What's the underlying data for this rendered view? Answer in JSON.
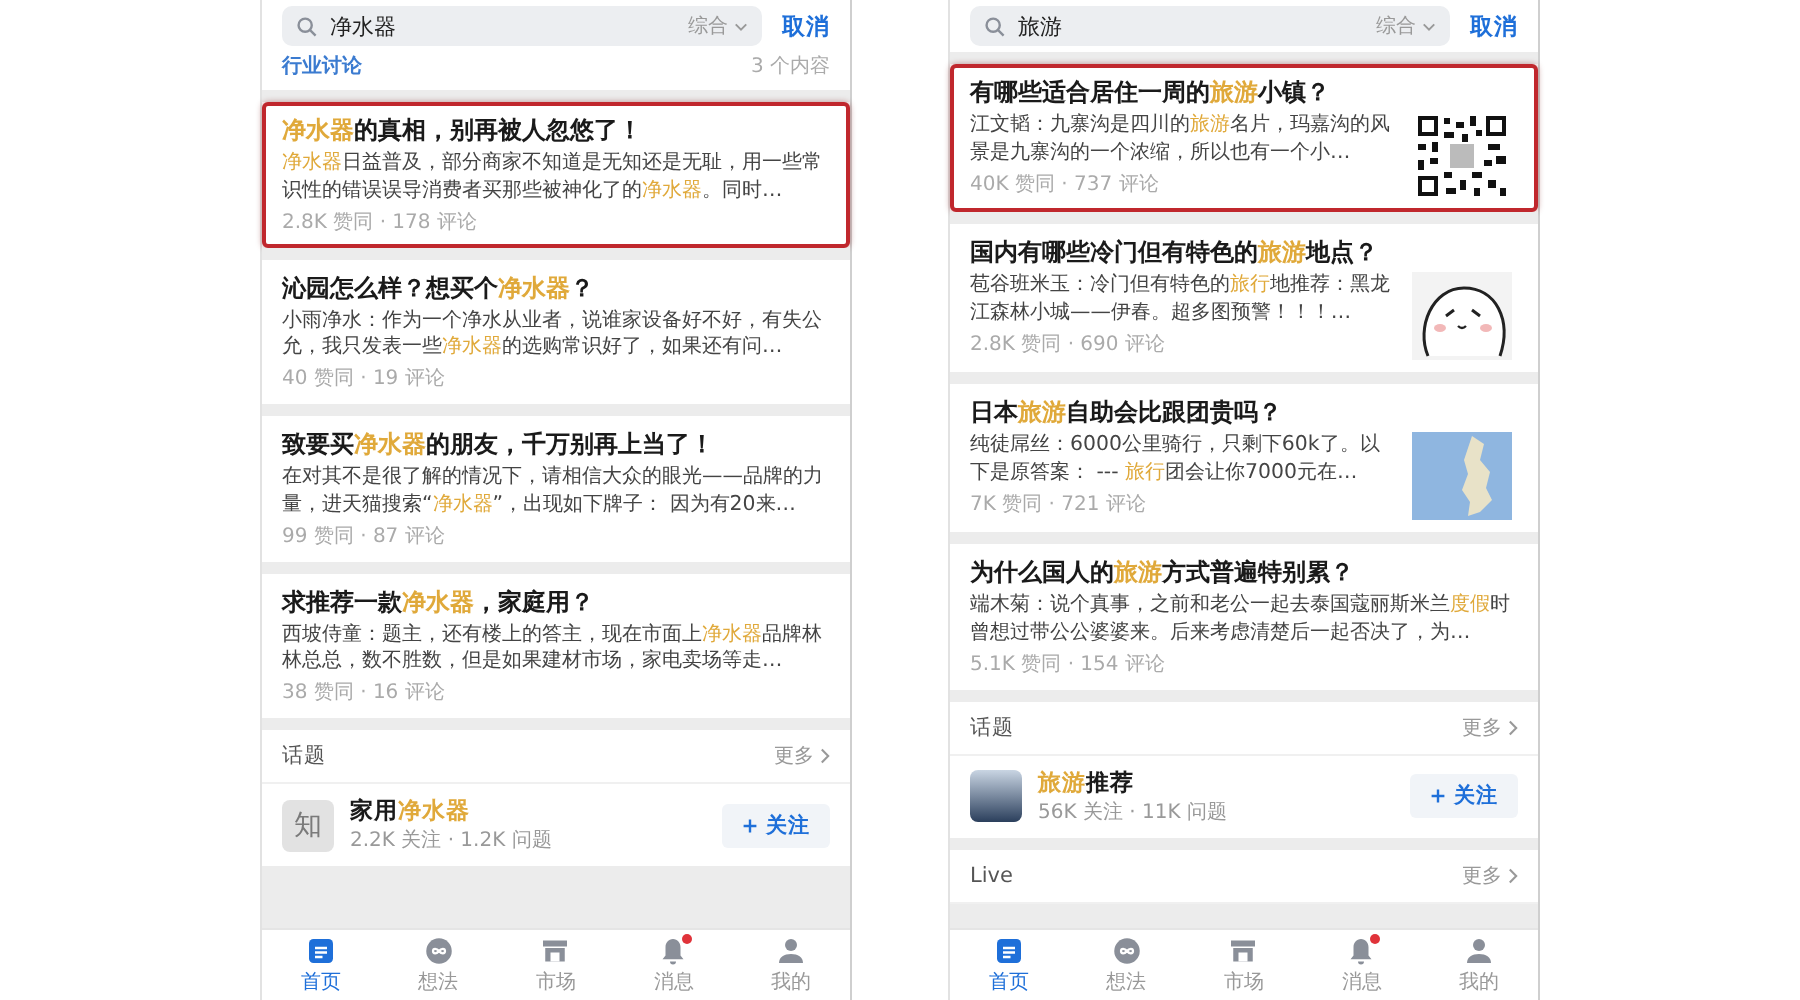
{
  "phones": [
    {
      "search": {
        "query": "净水器",
        "filter": "综合",
        "cancel": "取消"
      },
      "section_header": {
        "title": "行业讨论",
        "count": "3 个内容"
      },
      "results": [
        {
          "marked": true,
          "title": [
            {
              "t": "净水器",
              "hl": true
            },
            {
              "t": "的真相，别再被人忽悠了！",
              "hl": false
            }
          ],
          "excerpt": [
            {
              "t": "净水器",
              "hl": true
            },
            {
              "t": "日益普及，部分商家不知道是无知还是无耻，用一些常识性的错误误导消费者买那些被神化了的",
              "hl": false
            },
            {
              "t": "净水器",
              "hl": true
            },
            {
              "t": "。同时…",
              "hl": false
            }
          ],
          "stats": "2.8K 赞同 · 178 评论"
        },
        {
          "marked": false,
          "title": [
            {
              "t": "沁园怎么样？想买个",
              "hl": false
            },
            {
              "t": "净水器",
              "hl": true
            },
            {
              "t": "？",
              "hl": false
            }
          ],
          "excerpt": [
            {
              "t": "小雨净水：作为一个净水从业者，说谁家设备好不好，有失公允，我只发表一些",
              "hl": false
            },
            {
              "t": "净水器",
              "hl": true
            },
            {
              "t": "的选购常识好了，如果还有问…",
              "hl": false
            }
          ],
          "stats": "40 赞同 · 19 评论"
        },
        {
          "marked": false,
          "title": [
            {
              "t": "致要买",
              "hl": false
            },
            {
              "t": "净水器",
              "hl": true
            },
            {
              "t": "的朋友，千万别再上当了！",
              "hl": false
            }
          ],
          "excerpt": [
            {
              "t": "在对其不是很了解的情况下，请相信大众的眼光——品牌的力量，进天猫搜索“",
              "hl": false
            },
            {
              "t": "净水器",
              "hl": true
            },
            {
              "t": "”，出现如下牌子： 因为有20来…",
              "hl": false
            }
          ],
          "stats": "99 赞同 · 87 评论"
        },
        {
          "marked": false,
          "title": [
            {
              "t": "求推荐一款",
              "hl": false
            },
            {
              "t": "净水器",
              "hl": true
            },
            {
              "t": "，家庭用？",
              "hl": false
            }
          ],
          "excerpt": [
            {
              "t": "西坡侍童：题主，还有楼上的答主，现在市面上",
              "hl": false
            },
            {
              "t": "净水器",
              "hl": true
            },
            {
              "t": "品牌林林总总，数不胜数，但是如果建材市场，家电卖场等走…",
              "hl": false
            }
          ],
          "stats": "38 赞同 · 16 评论"
        }
      ],
      "topics": {
        "title": "话题",
        "more": "更多",
        "items": [
          {
            "avatar": {
              "kind": "letter",
              "text": "知"
            },
            "name": [
              {
                "t": "家用",
                "hl": false
              },
              {
                "t": "净水器",
                "hl": true
              }
            ],
            "stats": "2.2K 关注 · 1.2K 问题",
            "follow": "关注"
          }
        ]
      },
      "tabs": [
        {
          "label": "首页",
          "selected": true,
          "badge": false
        },
        {
          "label": "想法",
          "selected": false,
          "badge": false
        },
        {
          "label": "市场",
          "selected": false,
          "badge": false
        },
        {
          "label": "消息",
          "selected": false,
          "badge": true
        },
        {
          "label": "我的",
          "selected": false,
          "badge": false
        }
      ]
    },
    {
      "search": {
        "query": "旅游",
        "filter": "综合",
        "cancel": "取消"
      },
      "results": [
        {
          "marked": true,
          "thumbnail": {
            "kind": "qr"
          },
          "title": [
            {
              "t": "有哪些适合居住一周的",
              "hl": false
            },
            {
              "t": "旅游",
              "hl": true
            },
            {
              "t": "小镇？",
              "hl": false
            }
          ],
          "excerpt": [
            {
              "t": "江文韬：九寨沟是四川的",
              "hl": false
            },
            {
              "t": "旅游",
              "hl": true
            },
            {
              "t": "名片，玛嘉沟的风景是九寨沟的一个浓缩，所以也有一个小…",
              "hl": false
            }
          ],
          "stats": "40K 赞同 · 737 评论"
        },
        {
          "marked": false,
          "thumbnail": {
            "kind": "cartoon"
          },
          "title": [
            {
              "t": "国内有哪些冷门但有特色的",
              "hl": false
            },
            {
              "t": "旅游",
              "hl": true
            },
            {
              "t": "地点？",
              "hl": false
            }
          ],
          "excerpt": [
            {
              "t": "苞谷班米玉：冷门但有特色的",
              "hl": false
            },
            {
              "t": "旅行",
              "hl": true
            },
            {
              "t": "地推荐：黑龙江森林小城——伊春。超多图预警！！！…",
              "hl": false
            }
          ],
          "stats": "2.8K 赞同 · 690 评论"
        },
        {
          "marked": false,
          "thumbnail": {
            "kind": "map"
          },
          "title": [
            {
              "t": "日本",
              "hl": false
            },
            {
              "t": "旅游",
              "hl": true
            },
            {
              "t": "自助会比跟团贵吗？",
              "hl": false
            }
          ],
          "excerpt": [
            {
              "t": "纯徒屌丝：6000公里骑行，只剩下60k了。以下是原答案： --- ",
              "hl": false
            },
            {
              "t": "旅行",
              "hl": true
            },
            {
              "t": "团会让你7000元在…",
              "hl": false
            }
          ],
          "stats": "7K 赞同 · 721 评论"
        },
        {
          "marked": false,
          "title": [
            {
              "t": "为什么国人的",
              "hl": false
            },
            {
              "t": "旅游",
              "hl": true
            },
            {
              "t": "方式普遍特别累？",
              "hl": false
            }
          ],
          "excerpt": [
            {
              "t": "端木菊：说个真事，之前和老公一起去泰国蔻丽斯米兰",
              "hl": false
            },
            {
              "t": "度假",
              "hl": true
            },
            {
              "t": "时曾想过带公公婆婆来。后来考虑清楚后一起否决了，为…",
              "hl": false
            }
          ],
          "stats": "5.1K 赞同 · 154 评论"
        }
      ],
      "topics": {
        "title": "话题",
        "more": "更多",
        "items": [
          {
            "avatar": {
              "kind": "photo"
            },
            "name": [
              {
                "t": "旅游",
                "hl": true
              },
              {
                "t": "推荐",
                "hl": false
              }
            ],
            "stats": "56K 关注 · 11K 问题",
            "follow": "关注"
          }
        ]
      },
      "live": {
        "title": "Live",
        "more": "更多"
      },
      "tabs": [
        {
          "label": "首页",
          "selected": true,
          "badge": false
        },
        {
          "label": "想法",
          "selected": false,
          "badge": false
        },
        {
          "label": "市场",
          "selected": false,
          "badge": false
        },
        {
          "label": "消息",
          "selected": false,
          "badge": true
        },
        {
          "label": "我的",
          "selected": false,
          "badge": false
        }
      ]
    }
  ]
}
